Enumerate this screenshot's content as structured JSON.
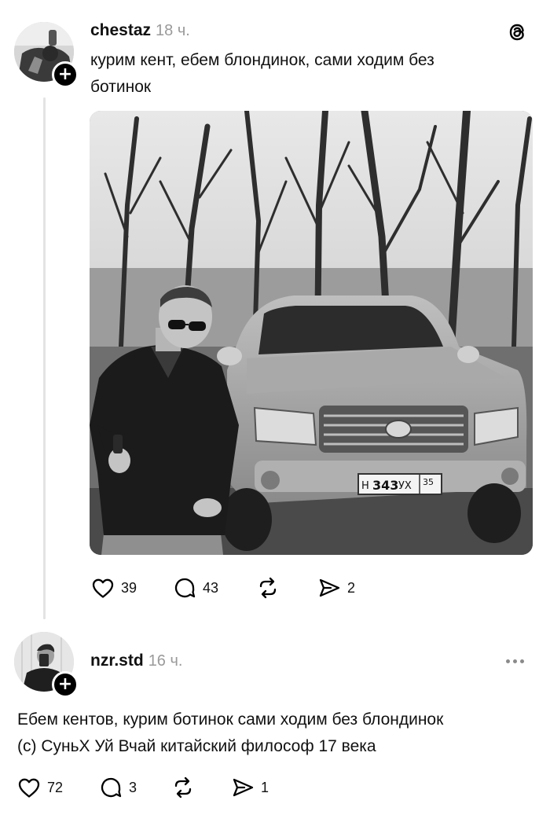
{
  "posts": [
    {
      "username": "chestaz",
      "time": "18 ч.",
      "text_line1": "курим кент, ебем блондинок, сами ходим без",
      "text_line2": "ботинок",
      "image": {
        "plate_series_left": "Н",
        "plate_number": "343",
        "plate_series_right": "УХ",
        "plate_region": "35"
      },
      "likes": "39",
      "comments": "43",
      "shares": "2",
      "has_threads_logo": true
    },
    {
      "username": "nzr.std",
      "time": "16 ч.",
      "text_line1": "Ебем кентов, курим ботинок сами ходим без блондинок",
      "text_line2": "(с) СуньХ Уй Вчай китайский философ 17 века",
      "likes": "72",
      "comments": "3",
      "shares": "1"
    }
  ],
  "icons": {
    "threads_logo": "threads-logo-icon",
    "like": "heart-icon",
    "comment": "comment-bubble-icon",
    "repost": "repost-icon",
    "share": "send-icon",
    "follow": "plus-icon",
    "more": "more-dots-icon"
  }
}
